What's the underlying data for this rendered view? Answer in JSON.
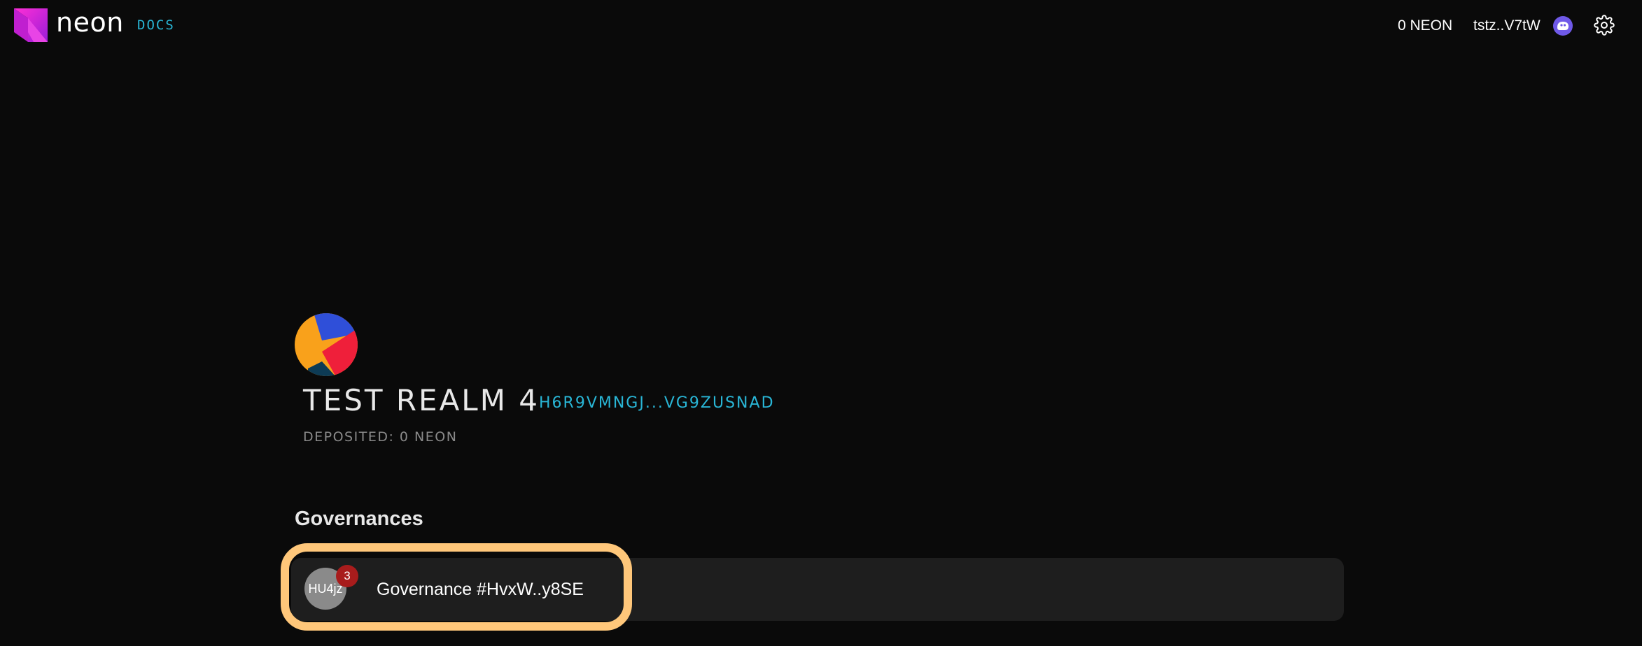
{
  "header": {
    "brand": "neon",
    "docs_label": "DOCS",
    "balance": "0 NEON",
    "wallet_address": "tstz..V7tW"
  },
  "realm": {
    "name": "TEST REALM 4",
    "address": "H6R9VMNGJ...VG9ZUSNAD",
    "deposited": "DEPOSITED: 0 NEON"
  },
  "governances": {
    "title": "Governances",
    "items": [
      {
        "avatar_text": "HU4jz",
        "badge_count": "3",
        "name": "Governance #HvxW..y8SE"
      }
    ]
  },
  "colors": {
    "accent": "#29b6d6",
    "highlight": "#ffc77a",
    "badge": "#a81c1c",
    "row_bg": "#1e1e1e"
  },
  "icons": [
    "neon-logo-icon",
    "phantom-wallet-icon",
    "gear-icon",
    "realm-logo-icon"
  ]
}
